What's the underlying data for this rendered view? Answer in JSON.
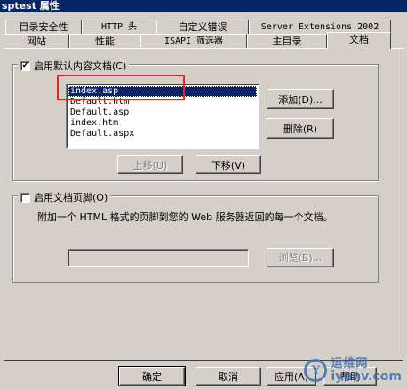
{
  "window": {
    "title": "sptest 属性"
  },
  "tabs_row1": [
    "目录安全性",
    "HTTP 头",
    "自定义错误",
    "Server Extensions 2002"
  ],
  "tabs_row2": [
    "网站",
    "性能",
    "ISAPI 筛选器",
    "主目录",
    "文档"
  ],
  "active_tab": "文档",
  "default_doc": {
    "checkbox_label": "启用默认内容文档(C)",
    "checked": true,
    "items": [
      "index.asp",
      "Default.htm",
      "Default.asp",
      "index.htm",
      "Default.aspx"
    ],
    "selected_index": 0,
    "add_label": "添加(D)...",
    "remove_label": "删除(R)",
    "move_up_label": "上移(U)",
    "move_down_label": "下移(V)"
  },
  "footer_section": {
    "checkbox_label": "启用文档页脚(O)",
    "checked": false,
    "description": "附加一个 HTML 格式的页脚到您的 Web 服务器返回的每一个文档。",
    "path_value": "",
    "browse_label": "浏览(B)..."
  },
  "dialog_buttons": {
    "ok": "确定",
    "cancel": "取消",
    "apply": "应用(A)",
    "help": "帮助"
  },
  "watermark": {
    "cn": "运维网",
    "en": "iyunv.com",
    "logo": "Y"
  },
  "colors": {
    "title_bg": "#0a246a",
    "face": "#d4d0c8",
    "highlight_box": "#e8251b",
    "watermark": "#3c6fb5"
  }
}
